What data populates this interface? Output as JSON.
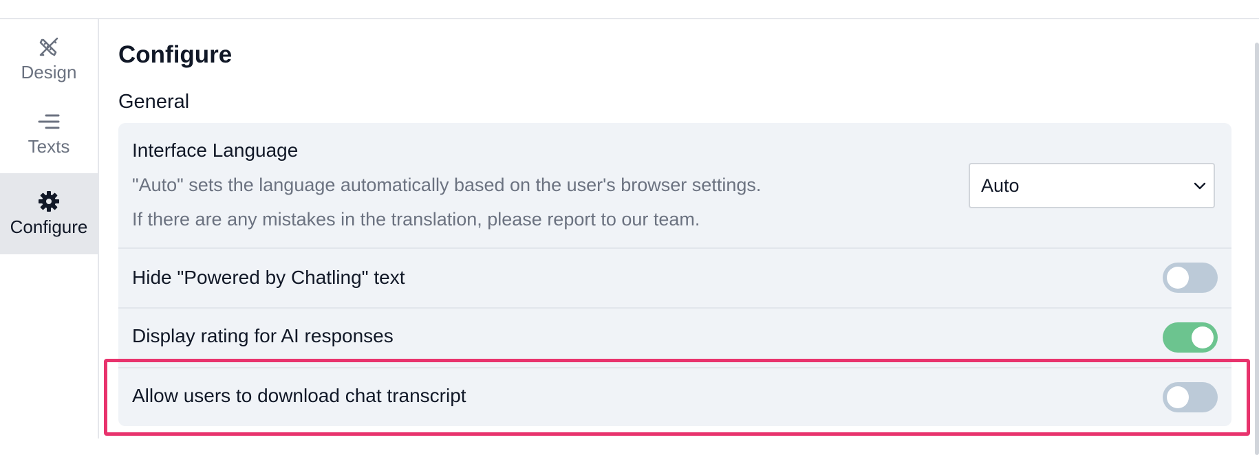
{
  "sidebar": {
    "items": [
      {
        "label": "Design",
        "icon": "design-pencil-ruler-icon"
      },
      {
        "label": "Texts",
        "icon": "text-lines-icon"
      },
      {
        "label": "Configure",
        "icon": "gear-icon",
        "active": true
      }
    ]
  },
  "main": {
    "title": "Configure",
    "section_title": "General",
    "settings": {
      "language": {
        "label": "Interface Language",
        "description_line1": "\"Auto\" sets the language automatically based on the user's browser settings.",
        "description_line2": "If there are any mistakes in the translation, please report to our team.",
        "selected": "Auto"
      },
      "hide_powered_by": {
        "label": "Hide \"Powered by Chatling\" text",
        "enabled": false
      },
      "display_rating": {
        "label": "Display rating for AI responses",
        "enabled": true
      },
      "allow_download": {
        "label": "Allow users to download chat transcript",
        "enabled": false
      }
    }
  },
  "colors": {
    "highlight": "#e8336d",
    "toggle_on": "#6cc48f",
    "toggle_off": "#bccad8",
    "panel_bg": "#f0f3f7"
  }
}
